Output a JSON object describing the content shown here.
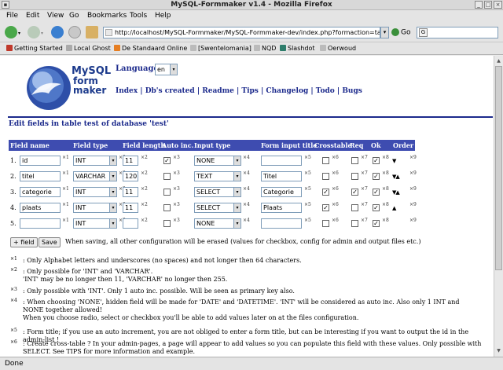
{
  "window": {
    "title": "MySQL-Formmaker v1.4 - Mozilla Firefox"
  },
  "menu": [
    "File",
    "Edit",
    "View",
    "Go",
    "Bookmarks",
    "Tools",
    "Help"
  ],
  "nav": {
    "url": "http://localhost/MySQL-Formmaker/MySQL-Formmaker-dev/index.php?formaction=table_",
    "go_label": "Go"
  },
  "bookmarks": [
    {
      "label": "Getting Started",
      "color": "#c0392b"
    },
    {
      "label": "Local Ghost",
      "color": "#888888"
    },
    {
      "label": "De Standaard Online",
      "color": "#e67e22"
    },
    {
      "label": "[Swentelomania]",
      "color": "#888888"
    },
    {
      "label": "NQD",
      "color": "#888888"
    },
    {
      "label": "Slashdot",
      "color": "#2e7d6b"
    },
    {
      "label": "Oerwoud",
      "color": "#888888"
    }
  ],
  "logo": {
    "line1": "MySQL",
    "line2": "form",
    "line3": "maker"
  },
  "language": {
    "label": "Language :",
    "value": "en"
  },
  "links": [
    "Index",
    "Db's created",
    "Readme",
    "Tips",
    "Changelog",
    "Todo",
    "Bugs"
  ],
  "heading": "Edit fields in table test of database 'test'",
  "columns": [
    "Field name",
    "Field type",
    "Field length",
    "Auto inc.",
    "Input type",
    "Form input title",
    "Crosstable",
    "Req",
    "Ok",
    "Order"
  ],
  "rows": [
    {
      "num": "1.",
      "name": "id",
      "type": "INT",
      "length": "11",
      "auto_inc": true,
      "input_type": "NONE",
      "title": "",
      "crosstable": false,
      "req": false,
      "ok": true,
      "up": false,
      "down": true
    },
    {
      "num": "2.",
      "name": "titel",
      "type": "VARCHAR",
      "length": "120",
      "auto_inc": false,
      "input_type": "TEXT",
      "title": "Titel",
      "crosstable": false,
      "req": false,
      "ok": true,
      "up": true,
      "down": true
    },
    {
      "num": "3.",
      "name": "categorie",
      "type": "INT",
      "length": "11",
      "auto_inc": false,
      "input_type": "SELECT",
      "title": "Categorie",
      "crosstable": true,
      "req": true,
      "ok": true,
      "up": true,
      "down": true
    },
    {
      "num": "4.",
      "name": "plaats",
      "type": "INT",
      "length": "11",
      "auto_inc": false,
      "input_type": "SELECT",
      "title": "Plaats",
      "crosstable": true,
      "req": false,
      "ok": true,
      "up": true,
      "down": false
    },
    {
      "num": "5.",
      "name": "",
      "type": "INT",
      "length": "",
      "auto_inc": false,
      "input_type": "NONE",
      "title": "",
      "crosstable": false,
      "req": false,
      "ok": true,
      "up": false,
      "down": false
    }
  ],
  "markers": {
    "name": "×1",
    "type": "×2",
    "length": "×2",
    "auto": "×3",
    "input": "×4",
    "title": "×5",
    "cross": "×6",
    "req": "×7",
    "ok": "×8",
    "order": "×9"
  },
  "buttons": {
    "add_field": "+ field",
    "save": "Save"
  },
  "save_note": "When saving, all other configuration will be erased (values for checkbox, config for admin and output files etc.)",
  "notes": [
    {
      "mark": "×1",
      "lines": [
        ": Only Alphabet letters and underscores (no spaces) and not longer then 64 characters."
      ]
    },
    {
      "mark": "×2",
      "lines": [
        ": Only possible for 'INT' and 'VARCHAR'.",
        "'INT' may be no longer then 11, 'VARCHAR' no longer then 255."
      ]
    },
    {
      "mark": "×3",
      "lines": [
        ": Only possible with 'INT'. Only 1 auto inc. possible. Will be seen as primary key also."
      ]
    },
    {
      "mark": "×4",
      "lines": [
        ": When choosing 'NONE', hidden field will be made for 'DATE' and 'DATETIME'. 'INT' will be considered as auto inc. Also only 1 INT and NONE together allowed!",
        "When you choose radio, select or checkbox you'll be able to add values later on at the files configuration."
      ]
    },
    {
      "mark": "×5",
      "lines": [
        ": Form title; if you use an auto increment, you are not obliged to enter a form title, but can be interesting if you want to output the id in the admin-list !"
      ]
    },
    {
      "mark": "×6",
      "lines": [
        ": Create cross-table ? In your admin-pages, a page will appear to add values so you can populate this field with these values. Only possible with SELECT. See TIPS for more information and example."
      ]
    }
  ],
  "status": "Done"
}
